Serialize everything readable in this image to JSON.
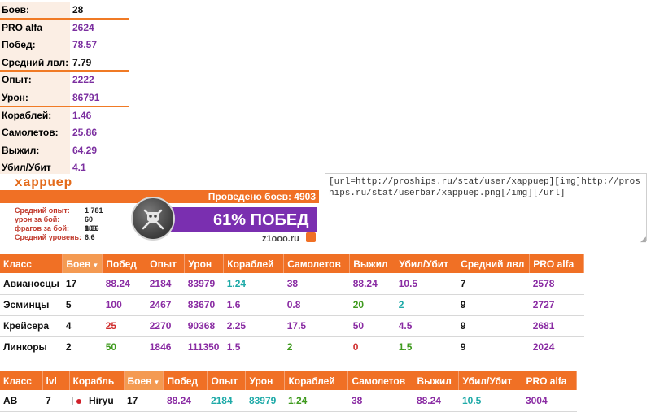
{
  "summary": [
    {
      "label": "Боев:",
      "value": "28",
      "color": "#111111",
      "sep": true
    },
    {
      "label": "PRO alfa",
      "value": "2624",
      "color": "#7b2fa0",
      "sep": false
    },
    {
      "label": "Побед:",
      "value": "78.57",
      "color": "#7b2fa0",
      "sep": false
    },
    {
      "label": "Средний лвл:",
      "value": "7.79",
      "color": "#111111",
      "sep": true
    },
    {
      "label": "Опыт:",
      "value": "2222",
      "color": "#7b2fa0",
      "sep": false
    },
    {
      "label": "Урон:",
      "value": "86791",
      "color": "#7b2fa0",
      "sep": true
    },
    {
      "label": "Кораблей:",
      "value": "1.46",
      "color": "#7b2fa0",
      "sep": false
    },
    {
      "label": "Самолетов:",
      "value": "25.86",
      "color": "#7b2fa0",
      "sep": false
    },
    {
      "label": "Выжил:",
      "value": "64.29",
      "color": "#7b2fa0",
      "sep": false
    },
    {
      "label": "Убил/Убит",
      "value": "4.1",
      "color": "#7b2fa0",
      "sep": true
    }
  ],
  "userbar": {
    "name": "xappuep",
    "battles": "Проведено боев: 4903",
    "stats": [
      {
        "label": "Средний опыт:",
        "value": "1 781"
      },
      {
        "label": "урон за бой:",
        "value": "60 886"
      },
      {
        "label": "фрагов за бой:",
        "value": "1.36"
      },
      {
        "label": "Средний уровень:",
        "value": "6.6"
      }
    ],
    "win_rate": "61% ПОБЕД",
    "site": "z1ooo.ru",
    "emblem_icon": "crossed-swords-emblem-icon"
  },
  "codebox": {
    "text": "[url=http://proships.ru/stat/user/xappuep][img]http://proships.ru/stat/userbar/xappuep.png[/img][/url]"
  },
  "class_table": {
    "headers": [
      "Класс",
      "Боев",
      "Побед",
      "Опыт",
      "Урон",
      "Кораблей",
      "Самолетов",
      "Выжил",
      "Убил/Убит",
      "Средний лвл",
      "PRO alfa"
    ],
    "sorted_column": 1,
    "rows": [
      {
        "cells": [
          {
            "v": "Авианосцы",
            "c": "c-black"
          },
          {
            "v": "17",
            "c": "c-black"
          },
          {
            "v": "88.24",
            "c": "c-purple"
          },
          {
            "v": "2184",
            "c": "c-purple"
          },
          {
            "v": "83979",
            "c": "c-purple"
          },
          {
            "v": "1.24",
            "c": "c-teal"
          },
          {
            "v": "38",
            "c": "c-purple"
          },
          {
            "v": "88.24",
            "c": "c-purple"
          },
          {
            "v": "10.5",
            "c": "c-purple"
          },
          {
            "v": "7",
            "c": "c-black"
          },
          {
            "v": "2578",
            "c": "c-purple"
          }
        ]
      },
      {
        "cells": [
          {
            "v": "Эсминцы",
            "c": "c-black"
          },
          {
            "v": "5",
            "c": "c-black"
          },
          {
            "v": "100",
            "c": "c-purple"
          },
          {
            "v": "2467",
            "c": "c-purple"
          },
          {
            "v": "83670",
            "c": "c-purple"
          },
          {
            "v": "1.6",
            "c": "c-purple"
          },
          {
            "v": "0.8",
            "c": "c-purple"
          },
          {
            "v": "20",
            "c": "c-green"
          },
          {
            "v": "2",
            "c": "c-teal"
          },
          {
            "v": "9",
            "c": "c-black"
          },
          {
            "v": "2727",
            "c": "c-purple"
          }
        ]
      },
      {
        "cells": [
          {
            "v": "Крейсера",
            "c": "c-black"
          },
          {
            "v": "4",
            "c": "c-black"
          },
          {
            "v": "25",
            "c": "c-red"
          },
          {
            "v": "2270",
            "c": "c-purple"
          },
          {
            "v": "90368",
            "c": "c-purple"
          },
          {
            "v": "2.25",
            "c": "c-purple"
          },
          {
            "v": "17.5",
            "c": "c-purple"
          },
          {
            "v": "50",
            "c": "c-purple"
          },
          {
            "v": "4.5",
            "c": "c-purple"
          },
          {
            "v": "9",
            "c": "c-black"
          },
          {
            "v": "2681",
            "c": "c-purple"
          }
        ]
      },
      {
        "cells": [
          {
            "v": "Линкоры",
            "c": "c-black"
          },
          {
            "v": "2",
            "c": "c-black"
          },
          {
            "v": "50",
            "c": "c-green"
          },
          {
            "v": "1846",
            "c": "c-purple"
          },
          {
            "v": "111350",
            "c": "c-purple"
          },
          {
            "v": "1.5",
            "c": "c-purple"
          },
          {
            "v": "2",
            "c": "c-green"
          },
          {
            "v": "0",
            "c": "c-red"
          },
          {
            "v": "1.5",
            "c": "c-green"
          },
          {
            "v": "9",
            "c": "c-black"
          },
          {
            "v": "2024",
            "c": "c-purple"
          }
        ]
      }
    ]
  },
  "ship_table": {
    "headers": [
      "Класс",
      "lvl",
      "Корабль",
      "Боев",
      "Побед",
      "Опыт",
      "Урон",
      "Кораблей",
      "Самолетов",
      "Выжил",
      "Убил/Убит",
      "PRO alfa"
    ],
    "sorted_column": 3,
    "rows": [
      {
        "cells": [
          {
            "v": "AB",
            "c": "c-black"
          },
          {
            "v": "7",
            "c": "c-black"
          },
          {
            "v": "Hiryu",
            "c": "c-black",
            "flag": "japan-flag-icon"
          },
          {
            "v": "17",
            "c": "c-black"
          },
          {
            "v": "88.24",
            "c": "c-purple"
          },
          {
            "v": "2184",
            "c": "c-teal"
          },
          {
            "v": "83979",
            "c": "c-teal"
          },
          {
            "v": "1.24",
            "c": "c-green"
          },
          {
            "v": "38",
            "c": "c-purple"
          },
          {
            "v": "88.24",
            "c": "c-purple"
          },
          {
            "v": "10.5",
            "c": "c-teal"
          },
          {
            "v": "3004",
            "c": "c-purple"
          }
        ]
      }
    ]
  },
  "colors": {
    "accent_orange": "#f07025",
    "value_purple": "#7b2fa0",
    "teal": "#1faaa8",
    "green": "#3f9a1e",
    "red": "#d02f2f",
    "win_bar_purple": "#7a2fb0"
  }
}
